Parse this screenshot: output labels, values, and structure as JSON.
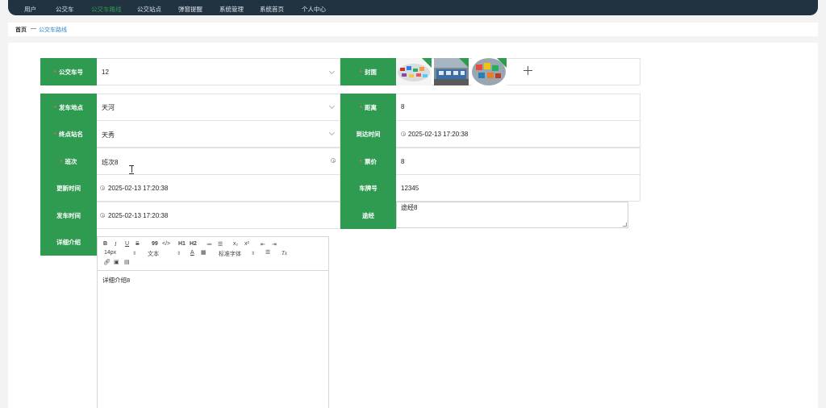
{
  "nav": {
    "items": [
      {
        "label": "用户",
        "active": false
      },
      {
        "label": "公交车",
        "active": false
      },
      {
        "label": "公交车路线",
        "active": true
      },
      {
        "label": "公交站点",
        "active": false
      },
      {
        "label": "弹窗提醒",
        "active": false
      },
      {
        "label": "系统管理",
        "active": false
      },
      {
        "label": "系统首页",
        "active": false
      },
      {
        "label": "个人中心",
        "active": false
      }
    ]
  },
  "breadcrumb": {
    "home": "首页",
    "separator": "—",
    "current": "公交车路线"
  },
  "form": {
    "bus_no": {
      "label": "公交车号",
      "required": true,
      "value": "12"
    },
    "cover": {
      "label": "封面",
      "required": true
    },
    "depart_place": {
      "label": "发车地点",
      "required": true,
      "value": "天河"
    },
    "distance": {
      "label": "距离",
      "required": true,
      "value": "8"
    },
    "terminal": {
      "label": "终点站名",
      "required": true,
      "value": "天秀"
    },
    "arrive_time": {
      "label": "到达时间",
      "required": false,
      "value": "2025-02-13 17:20:38"
    },
    "shift": {
      "label": "班次",
      "required": true,
      "value": "班次8"
    },
    "fare": {
      "label": "票价",
      "required": true,
      "value": "8"
    },
    "update_time": {
      "label": "更新时间",
      "required": false,
      "value": "2025-02-13 17:20:38"
    },
    "plate": {
      "label": "车牌号",
      "required": false,
      "value": "12345"
    },
    "depart_time": {
      "label": "发车时间",
      "required": false,
      "value": "2025-02-13 17:20:38"
    },
    "via": {
      "label": "途经",
      "required": false,
      "value": "途经8"
    },
    "detail": {
      "label": "详细介绍",
      "required": false,
      "value": "详细介绍8"
    }
  },
  "editor": {
    "tools_row1": [
      "B",
      "I",
      "U",
      "S",
      "99",
      "</>",
      "H1",
      "H2",
      "≔",
      "☰",
      "x₂",
      "x²",
      "⇤",
      "⇥"
    ],
    "font_size": "14px",
    "block_type": "文本",
    "font_family": "标准字体",
    "color_tool": "A",
    "clear_tool": "Tx"
  },
  "colors": {
    "nav_bg": "#213241",
    "accent": "#2e9b51",
    "link": "#2e87c7",
    "required": "#ff5b5b"
  }
}
